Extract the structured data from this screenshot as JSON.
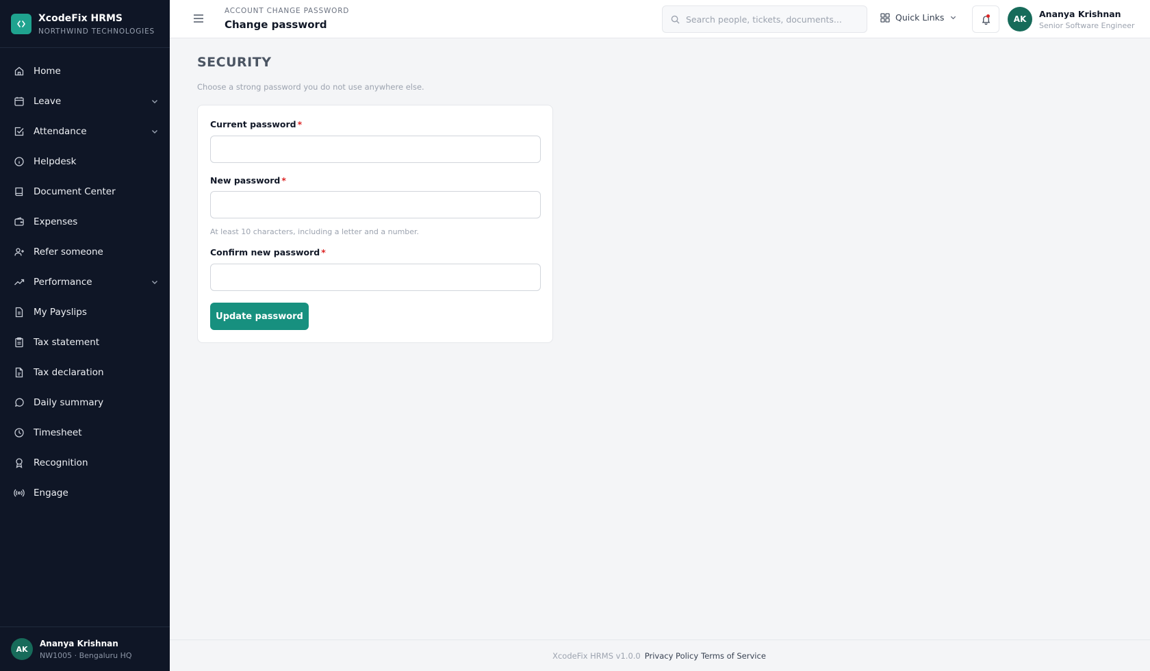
{
  "brand": {
    "name": "XcodeFix HRMS",
    "org": "NORTHWIND TECHNOLOGIES",
    "logo_icon": "code-brackets-icon",
    "accent": "#1fa38f"
  },
  "sidebar": {
    "items": [
      {
        "label": "Home",
        "icon": "home-icon"
      },
      {
        "label": "Leave",
        "icon": "calendar-icon",
        "expandable": true
      },
      {
        "label": "Attendance",
        "icon": "check-square-icon",
        "expandable": true
      },
      {
        "label": "Helpdesk",
        "icon": "info-icon"
      },
      {
        "label": "Document Center",
        "icon": "book-icon"
      },
      {
        "label": "Expenses",
        "icon": "wallet-icon"
      },
      {
        "label": "Refer someone",
        "icon": "user-plus-icon"
      },
      {
        "label": "Performance",
        "icon": "trending-up-icon",
        "expandable": true
      },
      {
        "label": "My Payslips",
        "icon": "file-text-icon"
      },
      {
        "label": "Tax statement",
        "icon": "clipboard-icon"
      },
      {
        "label": "Tax declaration",
        "icon": "file-icon"
      },
      {
        "label": "Daily summary",
        "icon": "message-circle-icon"
      },
      {
        "label": "Timesheet",
        "icon": "clock-icon"
      },
      {
        "label": "Recognition",
        "icon": "award-icon"
      },
      {
        "label": "Engage",
        "icon": "radio-icon"
      }
    ],
    "user": {
      "initials": "AK",
      "name": "Ananya Krishnan",
      "sub": "NW1005 · Bengaluru HQ"
    }
  },
  "header": {
    "breadcrumb": "ACCOUNT CHANGE PASSWORD",
    "title": "Change password",
    "search_placeholder": "Search people, tickets, documents...",
    "quick_links_label": "Quick Links",
    "user": {
      "initials": "AK",
      "name": "Ananya Krishnan",
      "role": "Senior Software Engineer"
    }
  },
  "main": {
    "section_title": "SECURITY",
    "section_subtitle": "Choose a strong password you do not use anywhere else.",
    "form": {
      "current_label": "Current password",
      "current_value": "",
      "new_label": "New password",
      "new_value": "",
      "new_hint": "At least 10 characters, including a letter and a number.",
      "confirm_label": "Confirm new password",
      "confirm_value": "",
      "required_mark": "*",
      "submit_label": "Update password"
    }
  },
  "footer": {
    "version": "XcodeFix HRMS v1.0.0",
    "privacy": "Privacy Policy",
    "terms": "Terms of Service"
  },
  "colors": {
    "sidebar_bg": "#0f1626",
    "primary_button": "#17907f",
    "required": "#dc2626",
    "avatar_bg": "#176b5a"
  }
}
